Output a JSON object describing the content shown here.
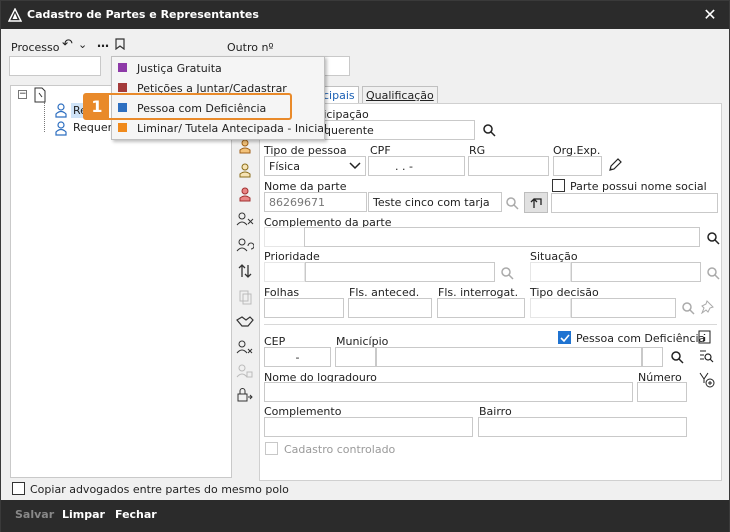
{
  "window": {
    "title": "Cadastro de Partes e Representantes",
    "close_symbol": "✕"
  },
  "header": {
    "processo_label": "Processo",
    "outro_label": "Outro nº"
  },
  "tree": {
    "root_item": "Re",
    "child_item": "Requere"
  },
  "context_menu": {
    "items": [
      {
        "label": "Justiça Gratuita",
        "color": "#8e3aa8"
      },
      {
        "label": "Petições a Juntar/Cadastrar",
        "color": "#a33a3a"
      },
      {
        "label": "Pessoa com Deficiência",
        "color": "#2e6fc0"
      },
      {
        "label": "Liminar/ Tutela Antecipada - Inicial",
        "color": "#f08a1c"
      }
    ],
    "callout_number": "1"
  },
  "tabs": [
    {
      "label": "cipais",
      "active": true
    },
    {
      "label": "Qualificação",
      "active": false
    }
  ],
  "form": {
    "participacao_label": "ticipação",
    "participacao_value": "querente",
    "tipo_pessoa_label": "Tipo de pessoa",
    "tipo_pessoa_value": "Física",
    "cpf_label": "CPF",
    "cpf_value": ". . -",
    "rg_label": "RG",
    "orgexp_label": "Org.Exp.",
    "nome_parte_label": "Nome da parte",
    "nome_parte_code": "86269671",
    "nome_parte_value": "Teste cinco com tarja",
    "nome_social_label": "Parte possui nome social",
    "complemento_parte_label": "Complemento da parte",
    "prioridade_label": "Prioridade",
    "situacao_label": "Situação",
    "folhas_label": "Folhas",
    "fls_anteced_label": "Fls. anteced.",
    "fls_interrogat_label": "Fls. interrogat.",
    "tipo_decisao_label": "Tipo decisão",
    "cep_label": "CEP",
    "cep_value": "-",
    "municipio_label": "Município",
    "pessoa_deficiencia_label": "Pessoa com Deficiência",
    "nome_logradouro_label": "Nome do logradouro",
    "numero_label": "Número",
    "complemento_label": "Complemento",
    "bairro_label": "Bairro",
    "cadastro_controlado_label": "Cadastro controlado"
  },
  "footer": {
    "copiar_label": "Copiar advogados entre partes do mesmo polo"
  },
  "bottom_buttons": {
    "salvar": "Salvar",
    "limpar": "Limpar",
    "fechar": "Fechar"
  },
  "colors": {
    "titlebar": "#2b2b2b",
    "accent": "#1f73d1",
    "callout": "#e98a2a"
  }
}
